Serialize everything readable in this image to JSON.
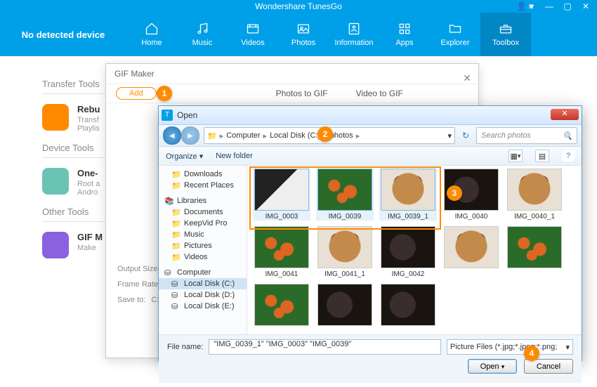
{
  "app": {
    "title": "Wondershare TunesGo"
  },
  "device_status": "No detected device",
  "nav": {
    "items": [
      {
        "label": "Home",
        "icon": "home"
      },
      {
        "label": "Music",
        "icon": "music"
      },
      {
        "label": "Videos",
        "icon": "video"
      },
      {
        "label": "Photos",
        "icon": "photo"
      },
      {
        "label": "Information",
        "icon": "info"
      },
      {
        "label": "Apps",
        "icon": "apps"
      },
      {
        "label": "Explorer",
        "icon": "folder"
      },
      {
        "label": "Toolbox",
        "icon": "toolbox"
      }
    ],
    "active": 7
  },
  "sidebar": {
    "sections": [
      {
        "title": "Transfer Tools",
        "tiles": [
          {
            "title": "Rebu",
            "desc": "Transf\nPlaylis",
            "color": "orange"
          }
        ]
      },
      {
        "title": "Device Tools",
        "tiles": [
          {
            "title": "One-",
            "desc": "Root a\nAndro",
            "color": "teal"
          }
        ]
      },
      {
        "title": "Other Tools",
        "tiles": [
          {
            "title": "GIF M",
            "desc": "Make",
            "color": "purple"
          }
        ]
      }
    ]
  },
  "gif_maker": {
    "window_title": "GIF Maker",
    "add_label": "Add",
    "tabs": [
      "Photos to GIF",
      "Video to GIF"
    ],
    "fields": {
      "output_size": "Output Size:",
      "frame_rate": "Frame Rate:",
      "save_to": "Save to:",
      "save_path": "C:\\Users\\Adm"
    }
  },
  "file_dialog": {
    "title": "Open",
    "breadcrumb": [
      "Computer",
      "Local Disk (C:)",
      "photos"
    ],
    "search_placeholder": "Search photos",
    "toolbar": {
      "organize": "Organize ▾",
      "new_folder": "New folder"
    },
    "tree": {
      "quick": [
        "Downloads",
        "Recent Places"
      ],
      "libraries_label": "Libraries",
      "libraries": [
        "Documents",
        "KeepVid Pro",
        "Music",
        "Pictures",
        "Videos"
      ],
      "computer_label": "Computer",
      "drives": [
        "Local Disk (C:)",
        "Local Disk (D:)",
        "Local Disk (E:)"
      ],
      "selected": "Local Disk (C:)"
    },
    "files": [
      {
        "name": "IMG_0003",
        "art": "bw",
        "selected": true
      },
      {
        "name": "IMG_0039",
        "art": "flowers",
        "selected": true
      },
      {
        "name": "IMG_0039_1",
        "art": "dog",
        "selected": true
      },
      {
        "name": "IMG_0040",
        "art": "dark",
        "selected": false
      },
      {
        "name": "IMG_0040_1",
        "art": "dog",
        "selected": false
      },
      {
        "name": "IMG_0041",
        "art": "flowers",
        "selected": false
      },
      {
        "name": "IMG_0041_1",
        "art": "dog",
        "selected": false
      },
      {
        "name": "IMG_0042",
        "art": "dark",
        "selected": false
      }
    ],
    "file_name_label": "File name:",
    "file_name_value": "\"IMG_0039_1\" \"IMG_0003\" \"IMG_0039\"",
    "filter": "Picture Files (*.jpg;*.jpeg;*.png;",
    "open_btn": "Open",
    "cancel_btn": "Cancel"
  },
  "badges": {
    "1": "1",
    "2": "2",
    "3": "3",
    "4": "4"
  }
}
